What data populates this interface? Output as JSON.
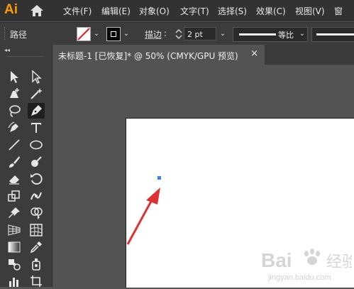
{
  "app": {
    "logo": "Ai"
  },
  "menu": {
    "items": [
      "文件(F)",
      "编辑(E)",
      "对象(O)",
      "文字(T)",
      "选择(S)",
      "效果(C)",
      "视图(V)",
      "窗"
    ]
  },
  "control_bar": {
    "label": "路径",
    "stroke_label": "描边",
    "stroke_weight": "2 pt",
    "profile_label": "等比"
  },
  "document_tab": {
    "title": "未标题-1 [已恢复]* @ 50% (CMYK/GPU 预览)",
    "close": "×"
  },
  "watermark": {
    "brand": "Bai",
    "sub": "jingyan.baidu.com"
  },
  "colors": {
    "anchor": "#3b82f6",
    "arrow": "#e03030",
    "logo": "#ff9a00"
  }
}
